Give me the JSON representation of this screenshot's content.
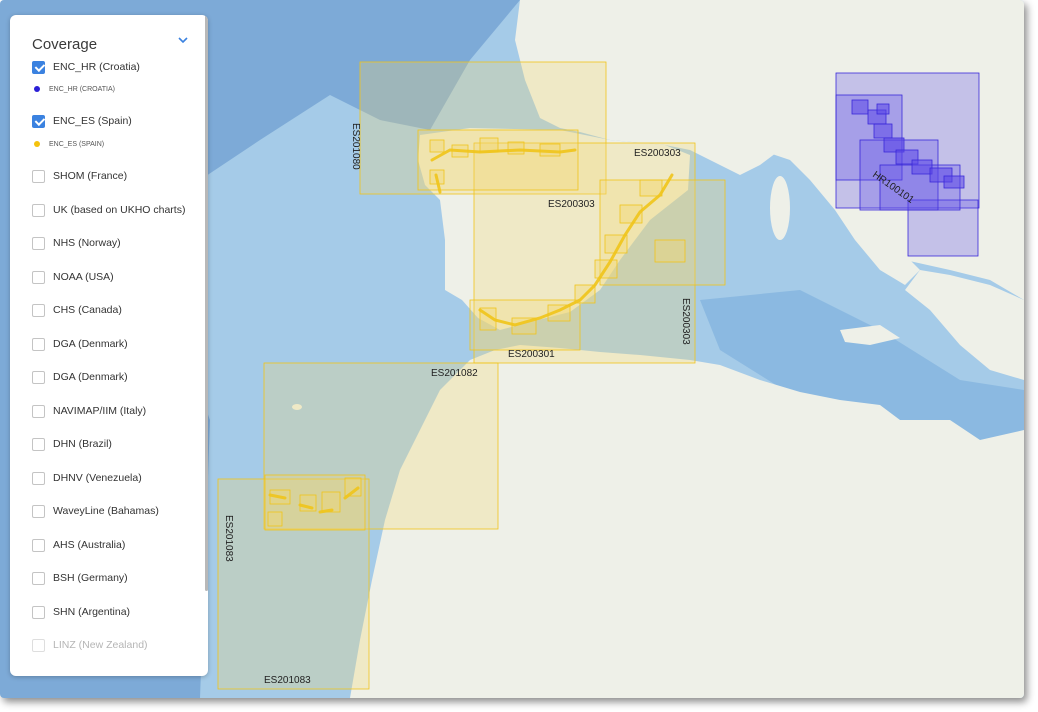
{
  "panel": {
    "title": "Coverage",
    "items": [
      {
        "label": "ENC_HR (Croatia)",
        "checked": true,
        "legend": "ENC_HR (CROATIA)",
        "legend_color": "#2b1fd6"
      },
      {
        "label": "ENC_ES (Spain)",
        "checked": true,
        "legend": "ENC_ES (SPAIN)",
        "legend_color": "#f4c20d"
      },
      {
        "label": "SHOM (France)",
        "checked": false
      },
      {
        "label": "UK (based on UKHO charts)",
        "checked": false
      },
      {
        "label": "NHS (Norway)",
        "checked": false
      },
      {
        "label": "NOAA (USA)",
        "checked": false
      },
      {
        "label": "CHS (Canada)",
        "checked": false
      },
      {
        "label": "DGA (Denmark)",
        "checked": false
      },
      {
        "label": "DGA (Denmark)",
        "checked": false
      },
      {
        "label": "NAVIMAP/IIM (Italy)",
        "checked": false
      },
      {
        "label": "DHN (Brazil)",
        "checked": false
      },
      {
        "label": "DHNV (Venezuela)",
        "checked": false
      },
      {
        "label": "WaveyLine (Bahamas)",
        "checked": false
      },
      {
        "label": "AHS (Australia)",
        "checked": false
      },
      {
        "label": "BSH (Germany)",
        "checked": false
      },
      {
        "label": "SHN (Argentina)",
        "checked": false
      },
      {
        "label": "LINZ (New Zealand)",
        "checked": false
      }
    ]
  },
  "map": {
    "colors": {
      "sea": "#a5cbe8",
      "land": "#eef0e8",
      "spain_fill": "#f3d771",
      "spain_stroke": "#f0c419",
      "croatia_fill": "#5b47e8",
      "croatia_stroke": "#3a28d9"
    },
    "labels": {
      "es201080": "ES201080",
      "es200303_top": "ES200303",
      "es200303_mid": "ES200303",
      "es200303_right": "ES200303",
      "es200301": "ES200301",
      "es201082": "ES201082",
      "es201083_side": "ES201083",
      "es201083_bottom": "ES201083",
      "hr100101": "HR100101"
    }
  }
}
